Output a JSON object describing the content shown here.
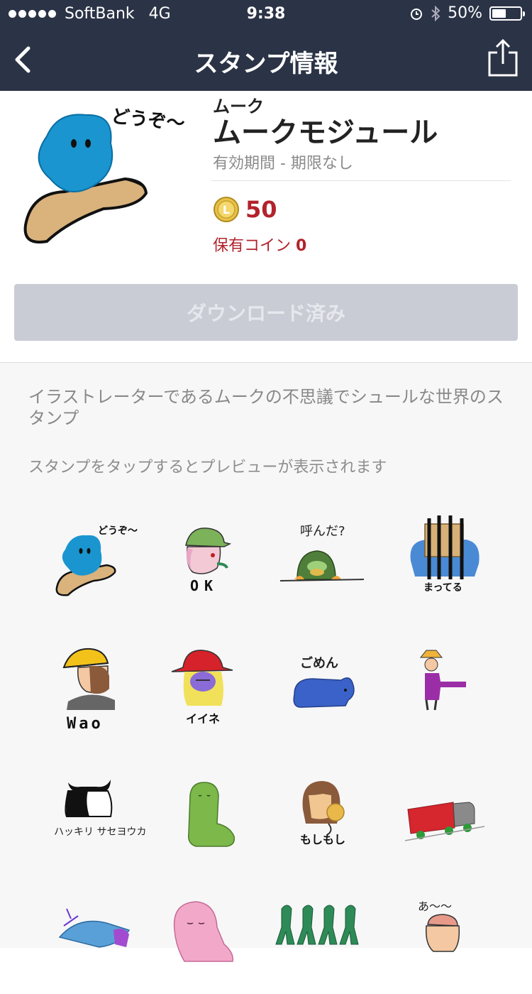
{
  "status_bar": {
    "carrier": "SoftBank",
    "network": "4G",
    "time": "9:38",
    "battery": "50%",
    "battery_level": 0.5,
    "icons": [
      "signal-dots-icon",
      "alarm-icon",
      "bluetooth-icon",
      "battery-icon"
    ]
  },
  "nav": {
    "title": "スタンプ情報",
    "back_icon": "chevron-left-icon",
    "share_icon": "share-icon"
  },
  "pack": {
    "author": "ムーク",
    "title": "ムークモジュール",
    "validity": "有効期間 - 期限なし",
    "price": "50",
    "owned_label": "保有コイン",
    "owned_value": "0",
    "download_label": "ダウンロード済み"
  },
  "description": "イラストレーターであるムークの不思議でシュールな世界のスタンプ",
  "preview_hint": "スタンプをタップするとプレビューが表示されます",
  "stickers": [
    {
      "caption": "どうぞ〜"
    },
    {
      "caption": "OK"
    },
    {
      "caption": "呼んだ?"
    },
    {
      "caption": "まってる"
    },
    {
      "caption": "Wao"
    },
    {
      "caption": "イイネ"
    },
    {
      "caption": "ごめん"
    },
    {
      "caption": ""
    },
    {
      "caption": "ハッキリ サセヨウカ"
    },
    {
      "caption": ""
    },
    {
      "caption": "もしもし"
    },
    {
      "caption": ""
    },
    {
      "caption": ""
    },
    {
      "caption": ""
    },
    {
      "caption": ""
    },
    {
      "caption": "あ〜〜"
    }
  ],
  "colors": {
    "nav_bg": "#2b3346",
    "price_red": "#b2232b",
    "button_disabled": "#c9ccd5",
    "list_bg": "#f7f7f8"
  }
}
